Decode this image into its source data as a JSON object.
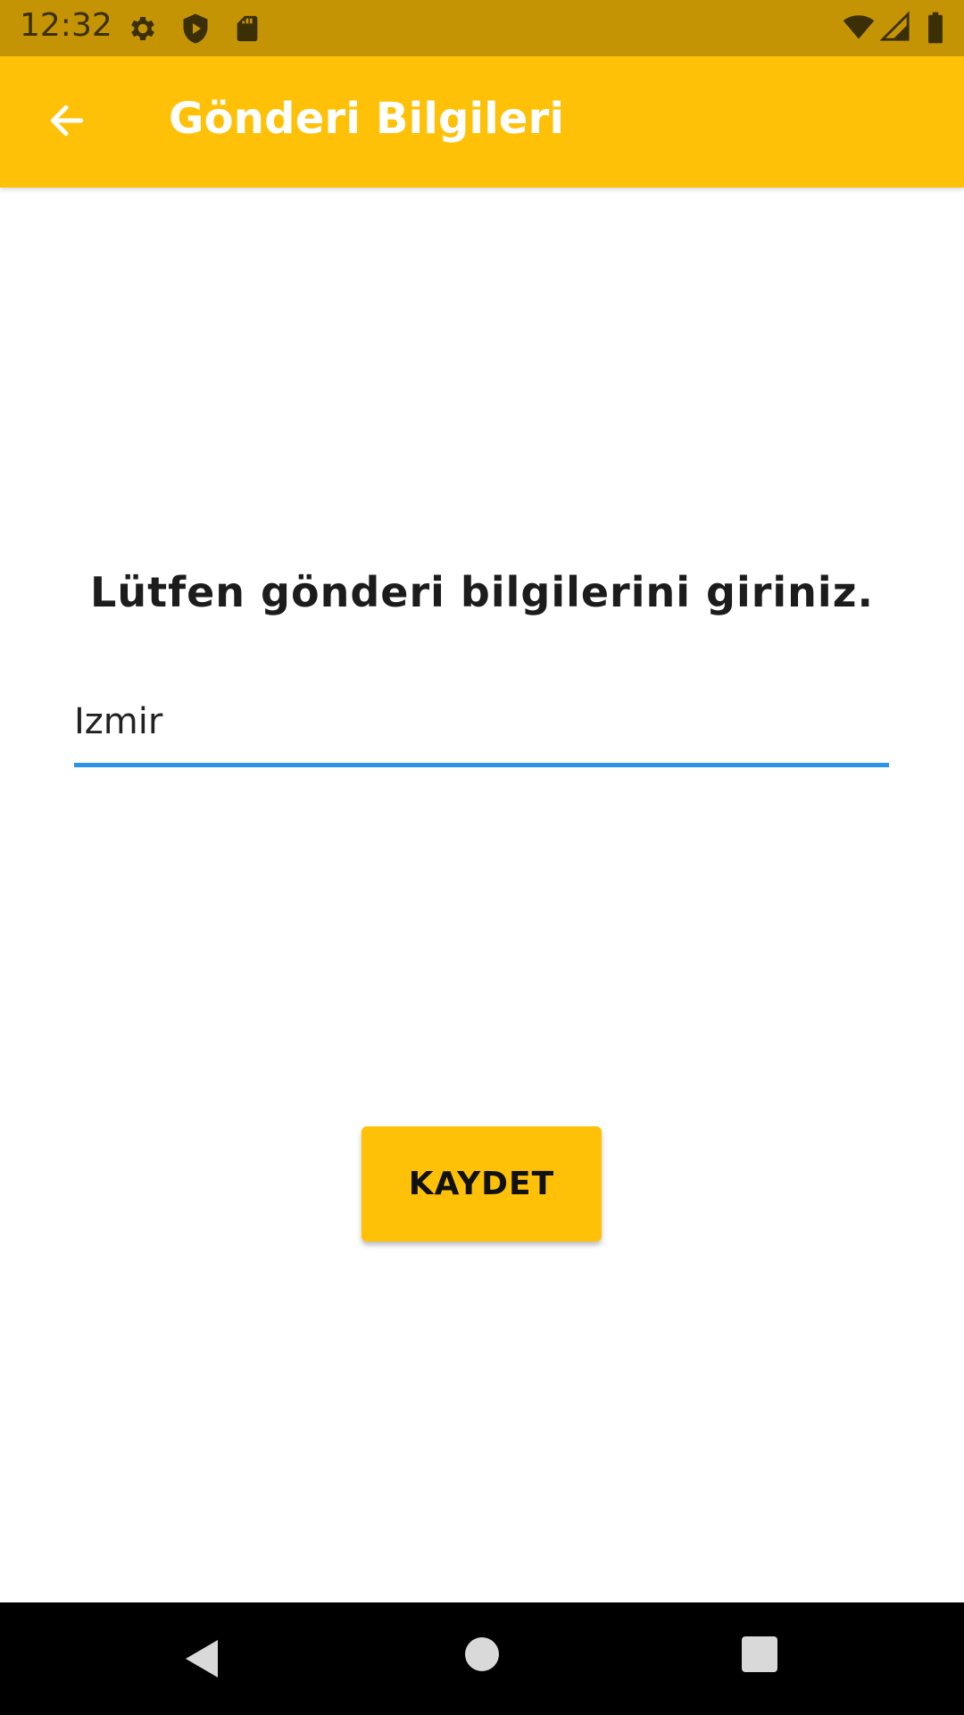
{
  "status_bar": {
    "time": "12:32",
    "icons": [
      "gear-icon",
      "shield-play-icon",
      "sd-card-icon",
      "wifi-icon",
      "signal-icon",
      "battery-icon"
    ]
  },
  "app_bar": {
    "title": "Gönderi Bilgileri",
    "back_icon": "arrow-back-icon",
    "color": "#fec107"
  },
  "form": {
    "prompt": "Lütfen gönderi bilgilerini giriniz.",
    "input_value": "Izmir",
    "underline_color": "#2a95e6"
  },
  "actions": {
    "save_label": "KAYDET"
  },
  "nav_bar": {
    "icons": [
      "back-triangle-icon",
      "home-circle-icon",
      "recents-square-icon"
    ]
  }
}
